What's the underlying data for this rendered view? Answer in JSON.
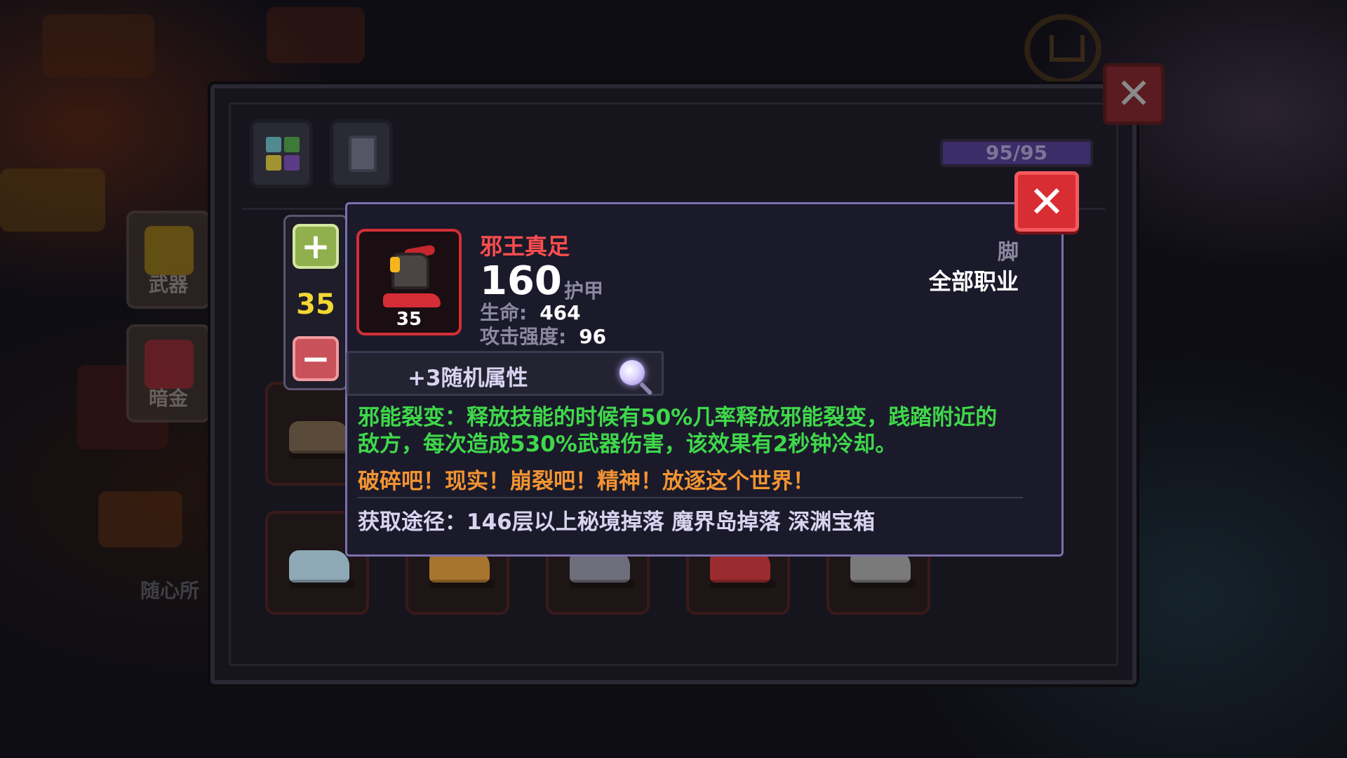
{
  "inventory": {
    "capacity": "95/95",
    "side_items": [
      {
        "label": "武器"
      },
      {
        "label": "暗金"
      }
    ],
    "side_free_label": "随心所"
  },
  "stepper": {
    "plus_label": "+",
    "minus_label": "−",
    "value": "35"
  },
  "tooltip": {
    "close_label": "✕",
    "item_level": "35",
    "item_name": "邪王真足",
    "armor_value": "160",
    "armor_label": "护甲",
    "stats": [
      {
        "label": "生命:",
        "value": "464"
      },
      {
        "label": "攻击强度:",
        "value": "96"
      }
    ],
    "slot_type": "脚",
    "class_req": "全部职业",
    "random_attr": "+3随机属性",
    "effect_text": "邪能裂变：释放技能的时候有50%几率释放邪能裂变，践踏附近的敌方，每次造成530%武器伤害，该效果有2秒钟冷却。",
    "quote_text": "破碎吧！现实！崩裂吧！精神！放逐这个世界！",
    "source_text": "获取途径：146层以上秘境掉落 魔界岛掉落 深渊宝箱"
  },
  "window": {
    "close_label": "✕"
  },
  "colors": {
    "item_name": "#ff4d4d",
    "effect": "#3fd84a",
    "quote": "#f29432",
    "level": "#f3d733",
    "popup_close": "#d72d33"
  }
}
